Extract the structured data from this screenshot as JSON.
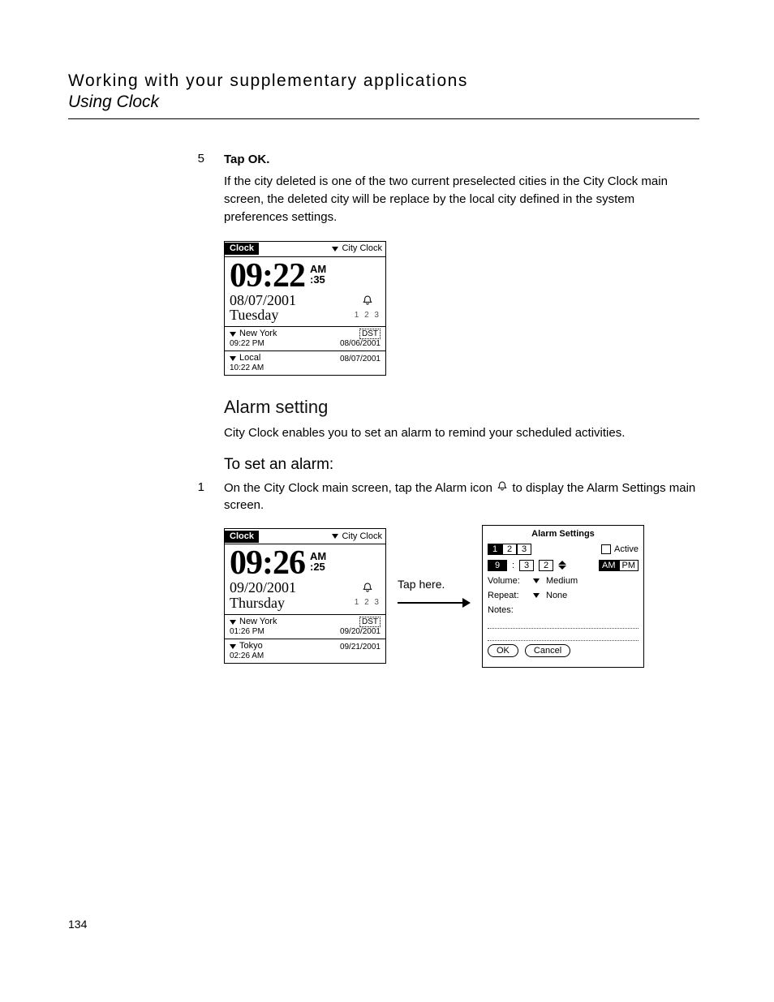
{
  "header": {
    "title": "Working with your supplementary applications",
    "subtitle": "Using Clock"
  },
  "page_number": "134",
  "steps": {
    "s5_num": "5",
    "s5_text": "Tap OK.",
    "s5_note": "If the city deleted is one of the two current preselected cities in the City Clock main screen, the deleted city will be replace by the local city defined in the system preferences settings.",
    "s1_num": "1",
    "s1_pre": "On the City Clock main screen, tap the Alarm icon ",
    "s1_post": " to display the Alarm Settings main screen."
  },
  "sections": {
    "alarm_setting": "Alarm setting",
    "alarm_setting_body": "City Clock enables you to set an alarm to remind your scheduled activities.",
    "to_set_alarm": "To set an alarm:"
  },
  "palm1": {
    "app": "Clock",
    "menu": "City Clock",
    "time": "09:22",
    "ampm_top": "AM",
    "ampm_bot": ":35",
    "date": "08/07/2001",
    "day": "Tuesday",
    "alarm_nums": "1 2 3",
    "city1": "New York",
    "city1_time": "09:22 PM",
    "city1_dst": "DST",
    "city1_date": "08/06/2001",
    "city2": "Local",
    "city2_time": "10:22 AM",
    "city2_date": "08/07/2001"
  },
  "palm2": {
    "app": "Clock",
    "menu": "City Clock",
    "time": "09:26",
    "ampm_top": "AM",
    "ampm_bot": ":25",
    "date": "09/20/2001",
    "day": "Thursday",
    "alarm_nums": "1 2 3",
    "city1": "New York",
    "city1_time": "01:26 PM",
    "city1_dst": "DST",
    "city1_date": "09/20/2001",
    "city2": "Tokyo",
    "city2_time": "02:26 AM",
    "city2_date": "09/21/2001"
  },
  "tap_here": "Tap here.",
  "alarm_settings": {
    "title": "Alarm Settings",
    "tab1": "1",
    "tab2": "2",
    "tab3": "3",
    "active": "Active",
    "hour": "9",
    "min1": "3",
    "min2": "2",
    "am": "AM",
    "pm": "PM",
    "volume_label": "Volume:",
    "volume_value": "Medium",
    "repeat_label": "Repeat:",
    "repeat_value": "None",
    "notes_label": "Notes:",
    "ok": "OK",
    "cancel": "Cancel"
  }
}
